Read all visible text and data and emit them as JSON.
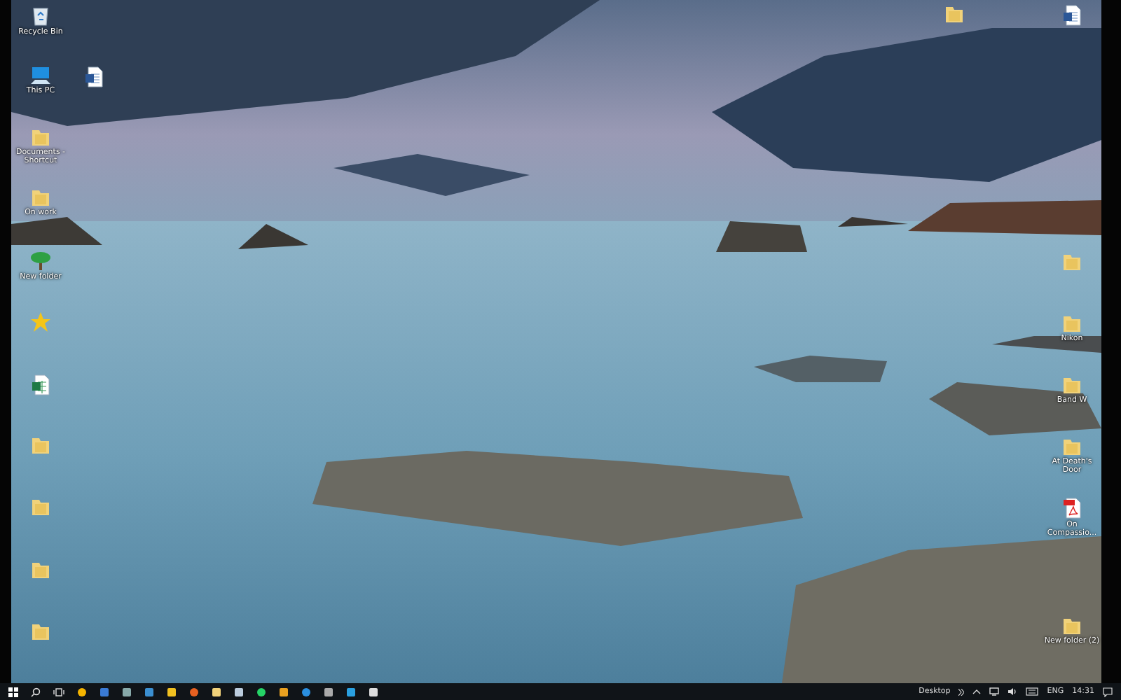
{
  "desktop": {
    "icons": [
      {
        "kind": "recycle",
        "label": "Recycle Bin"
      },
      {
        "kind": "pc",
        "label": "This PC"
      },
      {
        "kind": "word"
      },
      {
        "kind": "folder",
        "label": "Documents - Shortcut"
      },
      {
        "kind": "folder",
        "label": "On work"
      },
      {
        "kind": "tree",
        "label": "New folder"
      },
      {
        "kind": "star"
      },
      {
        "kind": "excel"
      },
      {
        "kind": "folder"
      },
      {
        "kind": "folder"
      },
      {
        "kind": "folder"
      },
      {
        "kind": "folder"
      },
      {
        "kind": "folder"
      },
      {
        "kind": "word"
      },
      {
        "kind": "folder"
      },
      {
        "kind": "folder",
        "label": "Nikon"
      },
      {
        "kind": "folder",
        "label": "Band W"
      },
      {
        "kind": "folder",
        "label": "At Death's Door"
      },
      {
        "kind": "pdf",
        "label": "On Compassio..."
      },
      {
        "kind": "folder",
        "label": "New folder (2)"
      }
    ]
  },
  "taskbar": {
    "toolbar_label": "Desktop",
    "language": "ENG",
    "time": "14:31"
  }
}
